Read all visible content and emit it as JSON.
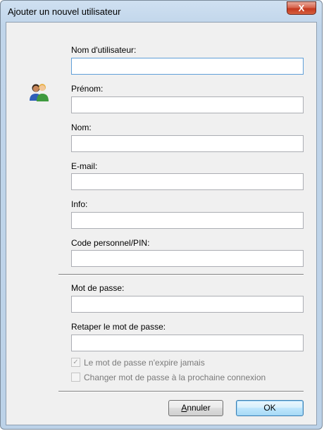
{
  "window": {
    "title": "Ajouter un nouvel utilisateur",
    "close_glyph": "X"
  },
  "icon": "users-icon",
  "fields": {
    "username": {
      "label": "Nom d'utilisateur:",
      "value": ""
    },
    "firstname": {
      "label": "Prénom:",
      "value": ""
    },
    "lastname": {
      "label": "Nom:",
      "value": ""
    },
    "email": {
      "label": "E-mail:",
      "value": ""
    },
    "info": {
      "label": "Info:",
      "value": ""
    },
    "pin": {
      "label": "Code personnel/PIN:",
      "value": ""
    },
    "password": {
      "label": "Mot de passe:",
      "value": ""
    },
    "password_confirm": {
      "label": "Retaper le mot de passe:",
      "value": ""
    }
  },
  "checkboxes": {
    "never_expires": {
      "label": "Le mot de passe n'expire jamais",
      "checked": true,
      "enabled": false
    },
    "change_next_login": {
      "label": "Changer mot de passe à la prochaine connexion",
      "checked": false,
      "enabled": false
    }
  },
  "buttons": {
    "cancel_first": "A",
    "cancel_rest": "nnuler",
    "ok": "OK"
  }
}
